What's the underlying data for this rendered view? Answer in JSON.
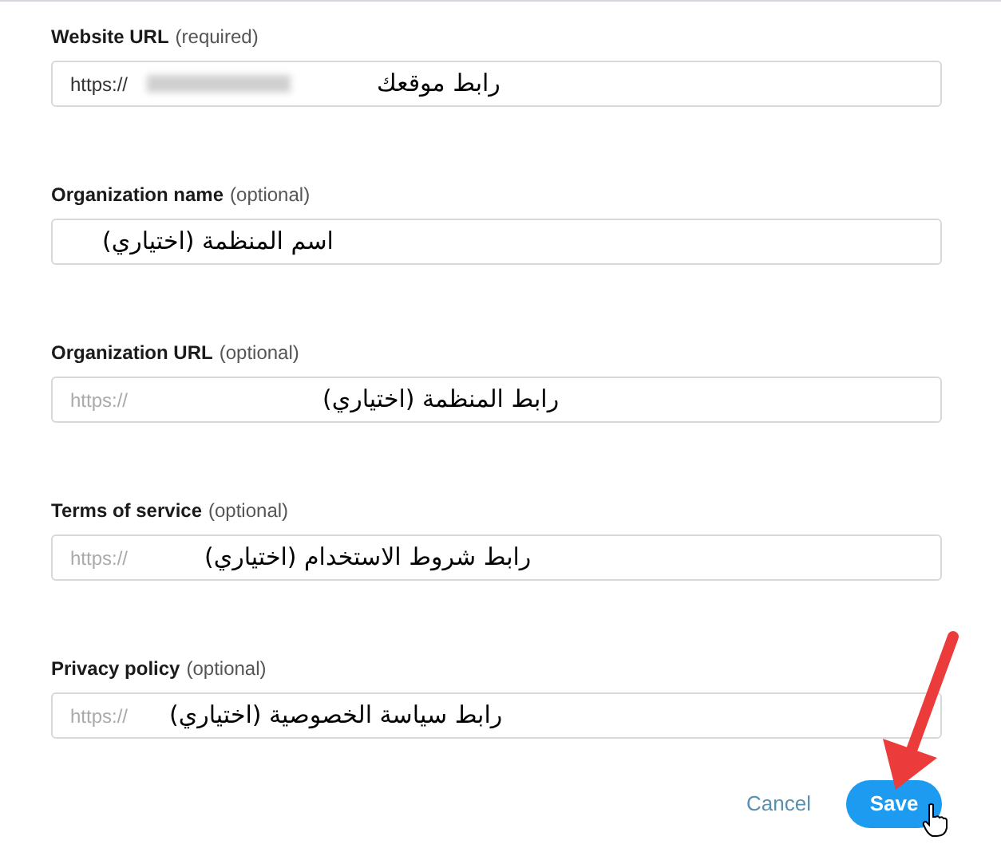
{
  "fields": [
    {
      "label": "Website URL",
      "hint": "(required)",
      "value": "https://",
      "redacted": true,
      "annotation": "رابط موقعك"
    },
    {
      "label": "Organization name",
      "hint": "(optional)",
      "annotation": "اسم المنظمة (اختياري)"
    },
    {
      "label": "Organization URL",
      "hint": "(optional)",
      "placeholder": "https://",
      "annotation": "رابط المنظمة (اختياري)"
    },
    {
      "label": "Terms of service",
      "hint": "(optional)",
      "placeholder": "https://",
      "annotation": "رابط شروط الاستخدام (اختياري)"
    },
    {
      "label": "Privacy policy",
      "hint": "(optional)",
      "placeholder": "https://",
      "annotation": "رابط سياسة الخصوصية (اختياري)"
    }
  ],
  "buttons": {
    "cancel": "Cancel",
    "save": "Save"
  }
}
